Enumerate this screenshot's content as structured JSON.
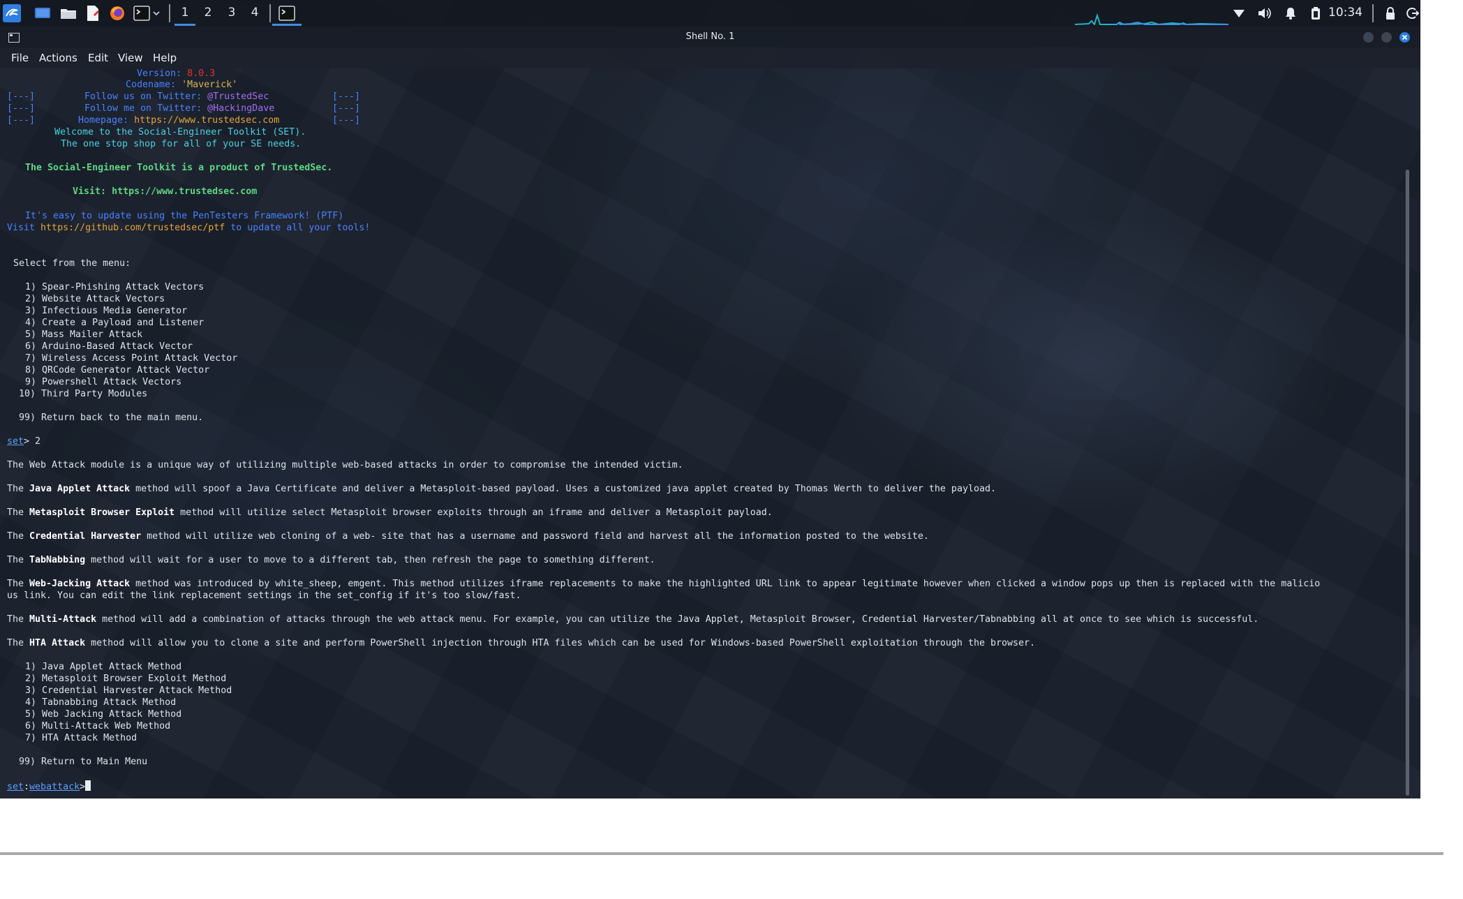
{
  "taskbar": {
    "workspaces": [
      "1",
      "2",
      "3",
      "4"
    ],
    "clock": "10:34"
  },
  "window": {
    "title": "Shell No. 1"
  },
  "menubar": [
    "File",
    "Actions",
    "Edit",
    "View",
    "Help"
  ],
  "colors": {
    "accent": "#3c8fe6",
    "terminal_bg": "#1f2634",
    "banner_green": "#5ed685",
    "banner_blue": "#4a80ff",
    "close_button": "#2b7de0"
  },
  "terminal": {
    "banner": {
      "version_label": "Version:",
      "version_value": "8.0.3",
      "codename_label": "Codename:",
      "codename_value": "'Maverick'",
      "bracket": "[---]",
      "twitter_us_label": "Follow us on Twitter:",
      "twitter_us_handle": "@TrustedSec",
      "twitter_me_label": "Follow me on Twitter:",
      "twitter_me_handle": "@HackingDave",
      "homepage_label": "Homepage:",
      "homepage_url": "https://www.trustedsec.com",
      "welcome": "Welcome to the Social-Engineer Toolkit (SET).",
      "tagline": "The one stop shop for all of your SE needs.",
      "product": "The Social-Engineer Toolkit is a product of TrustedSec.",
      "visit_label": "Visit:",
      "visit_url": "https://www.trustedsec.com",
      "ptf_line1": "It's easy to update using the PenTesters Framework! (PTF)",
      "ptf_visit": "Visit",
      "ptf_url": "https://github.com/trustedsec/ptf",
      "ptf_suffix": "to update all your tools!"
    },
    "select_prompt": "Select from the menu:",
    "main_menu": [
      "1) Spear-Phishing Attack Vectors",
      "2) Website Attack Vectors",
      "3) Infectious Media Generator",
      "4) Create a Payload and Listener",
      "5) Mass Mailer Attack",
      "6) Arduino-Based Attack Vector",
      "7) Wireless Access Point Attack Vector",
      "8) QRCode Generator Attack Vector",
      "9) Powershell Attack Vectors",
      "10) Third Party Modules"
    ],
    "main_return": "99) Return back to the main menu.",
    "prompt1_set": "set",
    "prompt1_rest": "> 2",
    "intro": "The Web Attack module is a unique way of utilizing multiple web-based attacks in order to compromise the intended victim.",
    "descriptions": [
      {
        "pre": "The ",
        "bold": "Java Applet Attack",
        "rest": " method will spoof a Java Certificate and deliver a Metasploit-based payload. Uses a customized java applet created by Thomas Werth to deliver the payload."
      },
      {
        "pre": "The ",
        "bold": "Metasploit Browser Exploit",
        "rest": " method will utilize select Metasploit browser exploits through an iframe and deliver a Metasploit payload."
      },
      {
        "pre": "The ",
        "bold": "Credential Harvester",
        "rest": " method will utilize web cloning of a web- site that has a username and password field and harvest all the information posted to the website."
      },
      {
        "pre": "The ",
        "bold": "TabNabbing",
        "rest": " method will wait for a user to move to a different tab, then refresh the page to something different."
      },
      {
        "pre": "The ",
        "bold": "Web-Jacking Attack",
        "rest": " method was introduced by white_sheep, emgent. This method utilizes iframe replacements to make the highlighted URL link to appear legitimate however when clicked a window pops up then is replaced with the malicio"
      },
      {
        "pre": "us link. You can edit the link replacement settings in the set_config if it's too slow/fast.",
        "bold": "",
        "rest": ""
      },
      {
        "pre": "The ",
        "bold": "Multi-Attack",
        "rest": " method will add a combination of attacks through the web attack menu. For example, you can utilize the Java Applet, Metasploit Browser, Credential Harvester/Tabnabbing all at once to see which is successful."
      },
      {
        "pre": "The ",
        "bold": "HTA Attack",
        "rest": " method will allow you to clone a site and perform PowerShell injection through HTA files which can be used for Windows-based PowerShell exploitation through the browser."
      }
    ],
    "web_menu": [
      "1) Java Applet Attack Method",
      "2) Metasploit Browser Exploit Method",
      "3) Credential Harvester Attack Method",
      "4) Tabnabbing Attack Method",
      "5) Web Jacking Attack Method",
      "6) Multi-Attack Web Method",
      "7) HTA Attack Method"
    ],
    "web_return": "99) Return to Main Menu",
    "prompt2_set": "set",
    "prompt2_colon": ":",
    "prompt2_module": "webattack",
    "prompt2_arrow": ">"
  }
}
